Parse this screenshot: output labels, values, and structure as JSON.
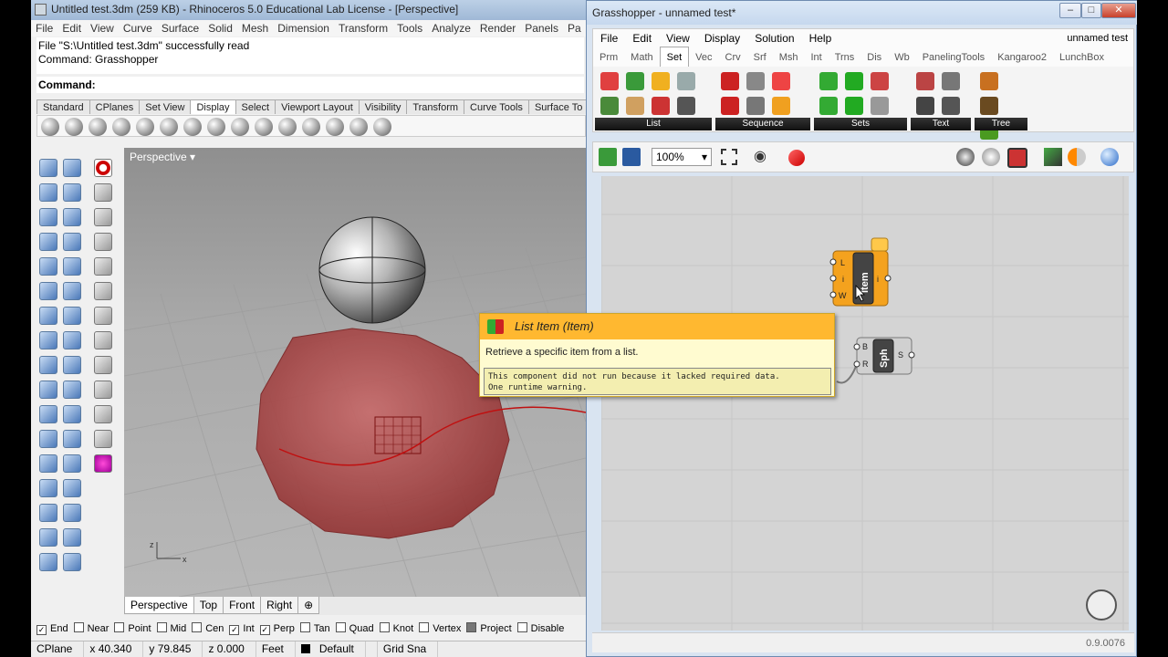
{
  "rhino": {
    "title": "Untitled test.3dm (259 KB) - Rhinoceros 5.0 Educational Lab License - [Perspective]",
    "menu": [
      "File",
      "Edit",
      "View",
      "Curve",
      "Surface",
      "Solid",
      "Mesh",
      "Dimension",
      "Transform",
      "Tools",
      "Analyze",
      "Render",
      "Panels",
      "Pa"
    ],
    "history": [
      "File \"S:\\Untitled test.3dm\" successfully read",
      "Command: Grasshopper"
    ],
    "command": "Command:",
    "tabs": [
      "Standard",
      "CPlanes",
      "Set View",
      "Display",
      "Select",
      "Viewport Layout",
      "Visibility",
      "Transform",
      "Curve Tools",
      "Surface To"
    ],
    "active_tab": "Display",
    "viewport_label": "Perspective",
    "viewport_tabs": [
      "Perspective",
      "Top",
      "Front",
      "Right",
      "⊕"
    ],
    "osnaps": [
      {
        "label": "End",
        "on": true
      },
      {
        "label": "Near",
        "on": false
      },
      {
        "label": "Point",
        "on": false
      },
      {
        "label": "Mid",
        "on": false
      },
      {
        "label": "Cen",
        "on": false
      },
      {
        "label": "Int",
        "on": true
      },
      {
        "label": "Perp",
        "on": true
      },
      {
        "label": "Tan",
        "on": false
      },
      {
        "label": "Quad",
        "on": false
      },
      {
        "label": "Knot",
        "on": false
      },
      {
        "label": "Vertex",
        "on": false
      },
      {
        "label": "Project",
        "on": false
      },
      {
        "label": "Disable",
        "on": false
      }
    ],
    "status": [
      "CPlane",
      "x 40.340",
      "y 79.845",
      "z 0.000",
      "Feet",
      "Default",
      "Grid Sna"
    ],
    "axis_x": "x",
    "axis_z": "z"
  },
  "grasshopper": {
    "title": "Grasshopper - unnamed test*",
    "menu": [
      "File",
      "Edit",
      "View",
      "Display",
      "Solution",
      "Help"
    ],
    "doc_name": "unnamed test",
    "tabs": [
      "Prm",
      "Math",
      "Set",
      "Vec",
      "Crv",
      "Srf",
      "Msh",
      "Int",
      "Trns",
      "Dis",
      "Wb",
      "PanelingTools",
      "Kangaroo2",
      "LunchBox"
    ],
    "active_tab": "Set",
    "groups": [
      "List",
      "Sequence",
      "Sets",
      "Text",
      "Tree"
    ],
    "zoom": "100%",
    "version": "0.9.0076",
    "item_node": {
      "name": "Item",
      "inputs": [
        "L",
        "i",
        "W"
      ],
      "output": "i"
    },
    "sphere_node": {
      "name": "Sph",
      "inputs": [
        "B",
        "R"
      ],
      "output": "S"
    },
    "tooltip": {
      "title": "List Item (Item)",
      "desc": "Retrieve a specific item from a list.",
      "warning1": "This component did not run because it lacked required data.",
      "warning2": "One runtime warning."
    }
  },
  "colors": {
    "accent": "#ffb830",
    "node_orange": "#f4a21e",
    "sphere_red": "#b03030"
  }
}
